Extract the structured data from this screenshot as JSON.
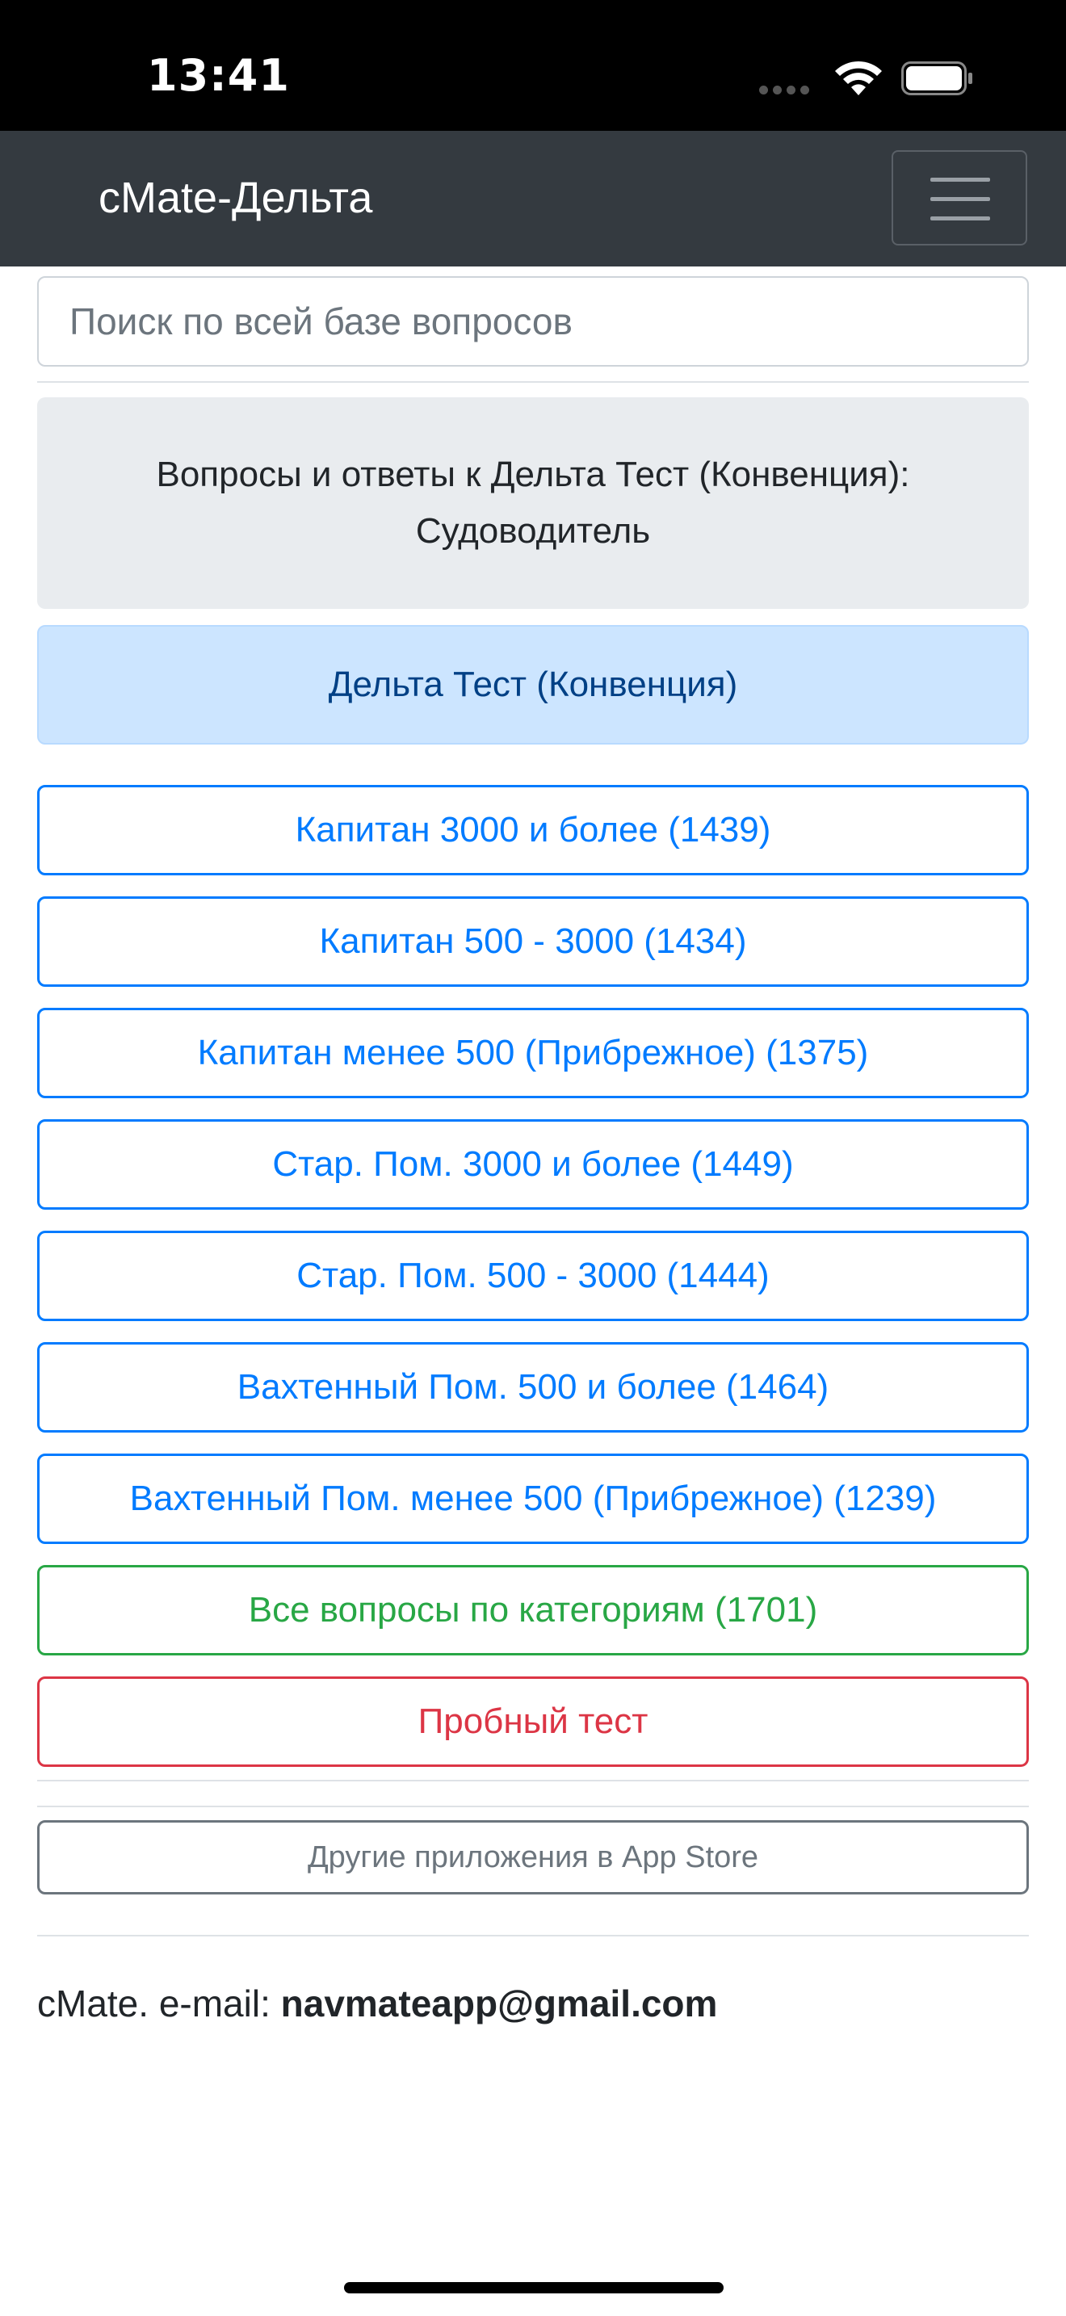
{
  "status": {
    "time": "13:41"
  },
  "navbar": {
    "brand": "cMate-Дельта"
  },
  "search": {
    "placeholder": "Поиск по всей базе вопросов"
  },
  "jumbotron": {
    "line1": "Вопросы и ответы к Дельта Тест (Конвенция):",
    "line2": "Судоводитель"
  },
  "alert": {
    "text": "Дельта Тест (Конвенция)"
  },
  "buttons": [
    {
      "label": "Капитан 3000 и более (1439)",
      "variant": "primary"
    },
    {
      "label": "Капитан 500 - 3000 (1434)",
      "variant": "primary"
    },
    {
      "label": "Капитан менее 500 (Прибрежное) (1375)",
      "variant": "primary"
    },
    {
      "label": "Стар. Пом. 3000 и более (1449)",
      "variant": "primary"
    },
    {
      "label": "Стар. Пом. 500 - 3000 (1444)",
      "variant": "primary"
    },
    {
      "label": "Вахтенный Пом. 500 и более (1464)",
      "variant": "primary"
    },
    {
      "label": "Вахтенный Пом. менее 500 (Прибрежное) (1239)",
      "variant": "primary"
    },
    {
      "label": "Все вопросы по категориям (1701)",
      "variant": "success"
    },
    {
      "label": "Пробный тест",
      "variant": "danger"
    }
  ],
  "other_apps": {
    "label": "Другие приложения в App Store"
  },
  "footer": {
    "prefix": "cMate. e-mail: ",
    "email": "navmateapp@gmail.com"
  },
  "colors": {
    "navbar": "#343a40",
    "primary": "#007bff",
    "success": "#28a745",
    "danger": "#dc3545",
    "secondary": "#6c757d",
    "alert_bg": "#cce5ff"
  },
  "icons": [
    "wifi-icon",
    "battery-icon",
    "cellular-dots-icon",
    "menu-icon"
  ]
}
